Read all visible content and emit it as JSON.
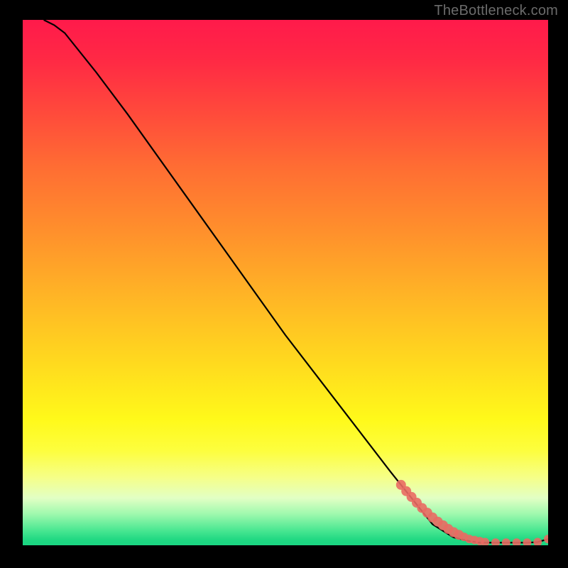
{
  "watermark": "TheBottleneck.com",
  "chart_data": {
    "type": "line",
    "title": "",
    "xlabel": "",
    "ylabel": "",
    "xlim": [
      0,
      100
    ],
    "ylim": [
      0,
      100
    ],
    "grid": false,
    "legend": false,
    "background_gradient": [
      "#ff1a4b",
      "#ff8f2c",
      "#fff91a",
      "#1ad582"
    ],
    "series": [
      {
        "name": "curve",
        "type": "line",
        "x": [
          4,
          6,
          8,
          10,
          14,
          20,
          30,
          40,
          50,
          60,
          70,
          78,
          82,
          85,
          87,
          88,
          90,
          92,
          94,
          96,
          98,
          100
        ],
        "y": [
          100,
          99,
          97.5,
          95,
          90,
          82,
          68,
          54,
          40,
          27,
          14,
          4,
          1.5,
          0.8,
          0.5,
          0.5,
          0.5,
          0.5,
          0.5,
          0.5,
          0.6,
          1.2
        ]
      },
      {
        "name": "cluster-points",
        "type": "scatter",
        "x": [
          72,
          73,
          74,
          75,
          76,
          77,
          78,
          79,
          80,
          81,
          82,
          83,
          84,
          85,
          86,
          87,
          88,
          90,
          92,
          94,
          96,
          98,
          100
        ],
        "y": [
          11.5,
          10.3,
          9.2,
          8.1,
          7.1,
          6.2,
          5.3,
          4.5,
          3.8,
          3.1,
          2.5,
          2.0,
          1.6,
          1.2,
          1.0,
          0.8,
          0.6,
          0.5,
          0.5,
          0.5,
          0.5,
          0.6,
          1.2
        ]
      }
    ]
  }
}
